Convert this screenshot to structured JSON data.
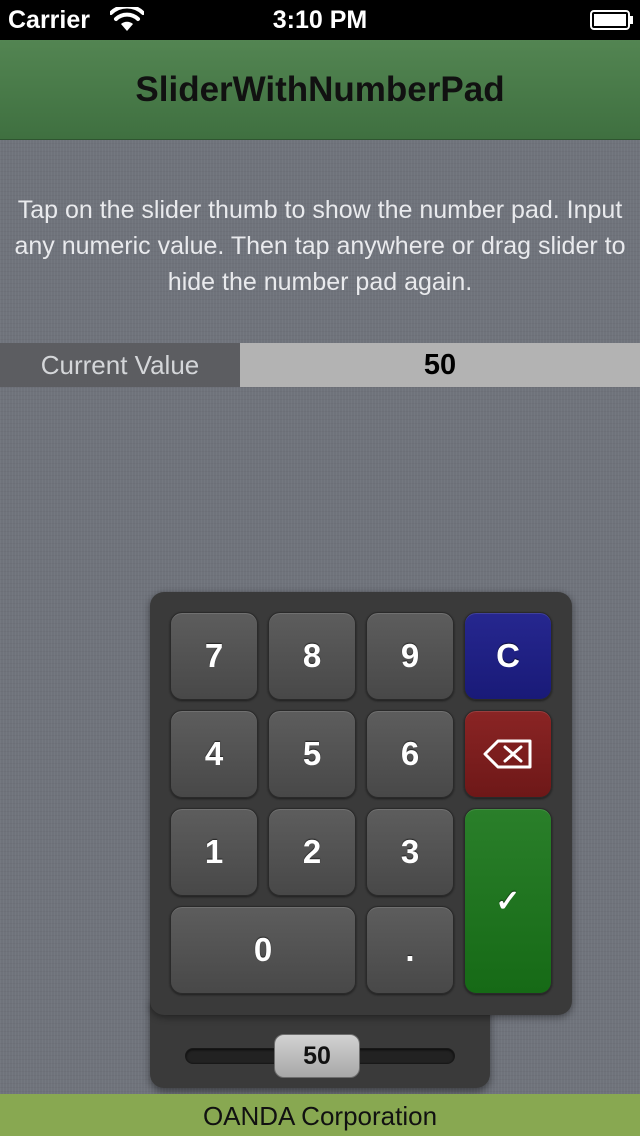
{
  "status_bar": {
    "carrier": "Carrier",
    "time": "3:10 PM",
    "wifi_icon": "wifi-icon",
    "battery_icon": "battery-full-icon"
  },
  "nav_bar": {
    "title": "SliderWithNumberPad",
    "color": "#4a7c4a"
  },
  "instructions": "Tap on the slider thumb to show the number pad. Input any numeric value. Then tap anywhere or drag slider to hide the number pad again.",
  "current_value": {
    "label": "Current Value",
    "value": "50"
  },
  "keypad": {
    "keys": {
      "k7": "7",
      "k8": "8",
      "k9": "9",
      "k4": "4",
      "k5": "5",
      "k6": "6",
      "k1": "1",
      "k2": "2",
      "k3": "3",
      "k0": "0",
      "dot": ".",
      "clear": "C",
      "backspace": "⌫",
      "done": "✓"
    },
    "colors": {
      "clear": "#1f2080",
      "backspace": "#7a1e1e",
      "done": "#1c741c"
    }
  },
  "slider": {
    "value": "50",
    "fraction": 0.5
  },
  "footer": {
    "text": "OANDA Corporation",
    "color": "#88a851"
  }
}
